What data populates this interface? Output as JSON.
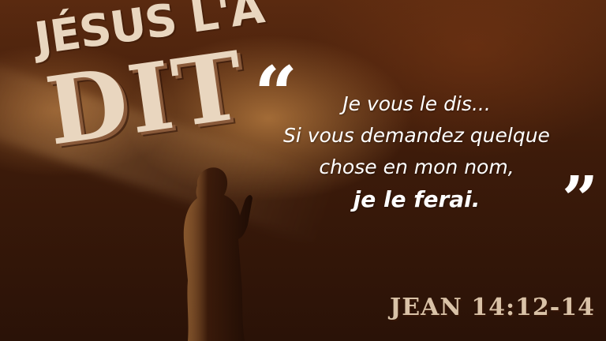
{
  "title": {
    "line1": "JÉSUS L'A",
    "line2": "DIT"
  },
  "quote": {
    "open_mark": "“",
    "close_mark": "”",
    "lines": [
      "Je vous le dis...",
      "Si vous demandez quelque",
      "chose en mon nom,",
      "je le ferai."
    ]
  },
  "reference": "JEAN 14:12-14",
  "colors": {
    "background_dark": "#2a1207",
    "background_warm": "#5a2a10",
    "title_cream": "#e9d6bf",
    "title_shadow": "#8a5a3a",
    "verse_text": "#ffffff",
    "reference_text": "#d9c2a7"
  }
}
